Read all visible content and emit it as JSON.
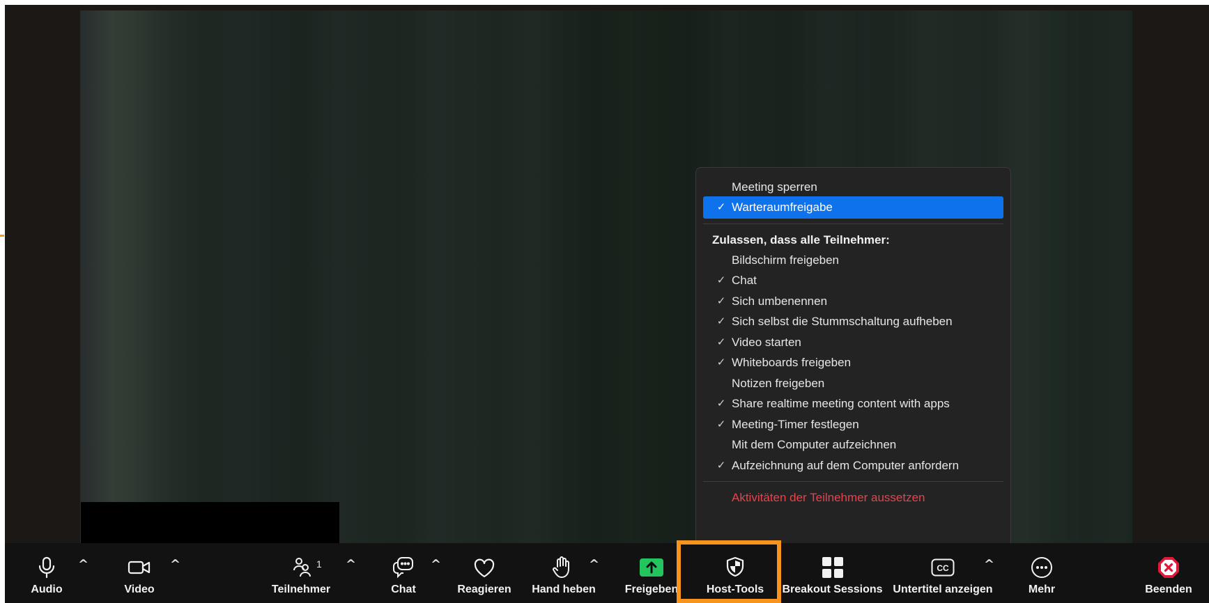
{
  "menu": {
    "items": [
      {
        "label": "Meeting sperren",
        "checked": false
      },
      {
        "label": "Warteraumfreigabe",
        "checked": true,
        "selected": true
      }
    ],
    "section_heading": "Zulassen, dass alle Teilnehmer:",
    "permissions": [
      {
        "label": "Bildschirm freigeben",
        "checked": false
      },
      {
        "label": "Chat",
        "checked": true
      },
      {
        "label": "Sich umbenennen",
        "checked": true
      },
      {
        "label": "Sich selbst die Stummschaltung aufheben",
        "checked": true
      },
      {
        "label": "Video starten",
        "checked": true
      },
      {
        "label": "Whiteboards freigeben",
        "checked": true
      },
      {
        "label": "Notizen freigeben",
        "checked": false
      },
      {
        "label": "Share realtime meeting content with apps",
        "checked": true
      },
      {
        "label": "Meeting-Timer festlegen",
        "checked": true
      },
      {
        "label": "Mit dem Computer aufzeichnen",
        "checked": false
      },
      {
        "label": "Aufzeichnung auf dem Computer anfordern",
        "checked": true
      }
    ],
    "suspend_label": "Aktivitäten der Teilnehmer aussetzen",
    "check_glyph": "✓"
  },
  "toolbar": {
    "audio": "Audio",
    "video": "Video",
    "participants": "Teilnehmer",
    "participants_count": "1",
    "chat": "Chat",
    "react": "Reagieren",
    "raise_hand": "Hand heben",
    "share": "Freigeben",
    "host_tools": "Host-Tools",
    "breakout": "Breakout Sessions",
    "captions": "Untertitel anzeigen",
    "more": "Mehr",
    "end": "Beenden",
    "caret": "^",
    "cc": "CC"
  },
  "colors": {
    "accent_blue": "#0e72ed",
    "share_green": "#22c55e",
    "danger_red": "#e8424b",
    "highlight_orange": "#f7941d"
  }
}
